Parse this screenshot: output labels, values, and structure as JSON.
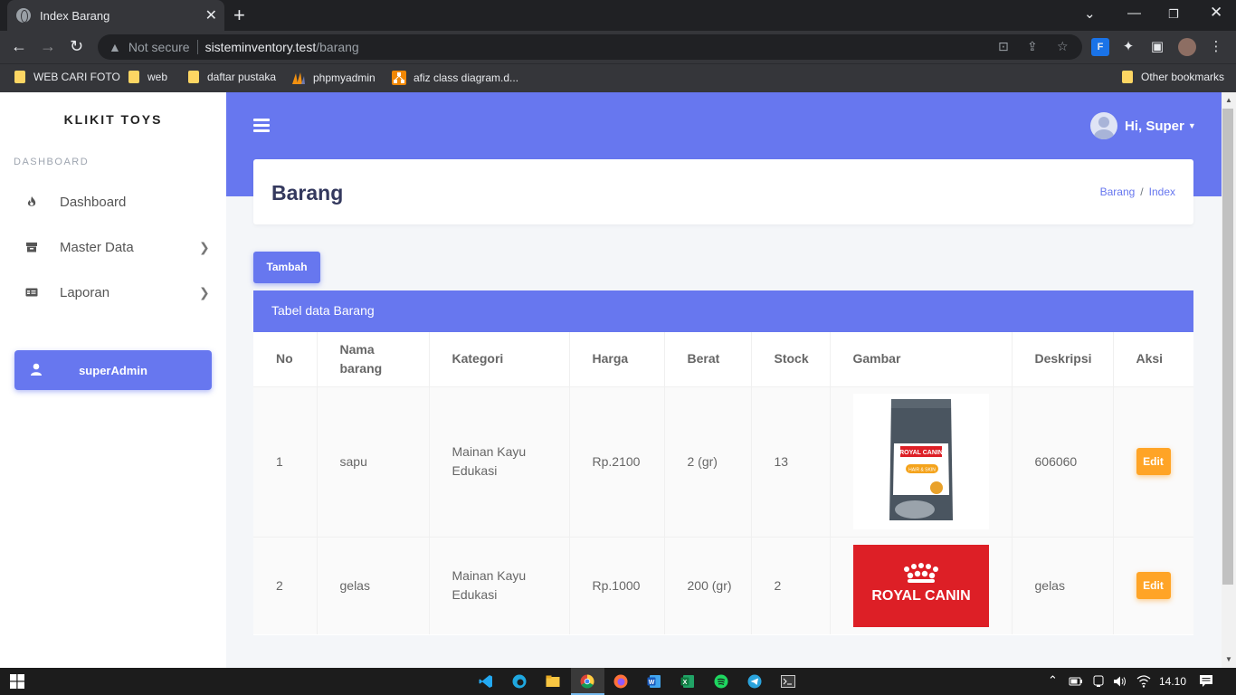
{
  "browser": {
    "tab_title": "Index Barang",
    "security_label": "Not secure",
    "url_host": "sisteminventory.test",
    "url_path": "/barang",
    "bookmarks": [
      {
        "label": "WEB CARI FOTO",
        "icon": "folder-icon"
      },
      {
        "label": "web",
        "icon": "folder-icon"
      },
      {
        "label": "daftar pustaka",
        "icon": "folder-icon"
      },
      {
        "label": "phpmyadmin",
        "icon": "phpmyadmin-icon"
      },
      {
        "label": "afiz class diagram.d...",
        "icon": "diagram-icon"
      }
    ],
    "other_bookmarks": "Other bookmarks"
  },
  "sidebar": {
    "brand": "KLIKIT TOYS",
    "section": "DASHBOARD",
    "items": [
      {
        "label": "Dashboard",
        "icon": "fire-icon"
      },
      {
        "label": "Master Data",
        "icon": "archive-icon"
      },
      {
        "label": "Laporan",
        "icon": "id-card-icon"
      }
    ],
    "user_button": "superAdmin"
  },
  "topbar": {
    "greeting": "Hi, Super"
  },
  "header": {
    "title": "Barang",
    "breadcrumb": [
      "Barang",
      "Index"
    ]
  },
  "actions": {
    "add_label": "Tambah"
  },
  "table": {
    "caption": "Tabel data Barang",
    "columns": [
      "No",
      "Nama barang",
      "Kategori",
      "Harga",
      "Berat",
      "Stock",
      "Gambar",
      "Deskripsi",
      "Aksi"
    ],
    "rows": [
      {
        "no": "1",
        "nama": "sapu",
        "kategori": "Mainan Kayu Edukasi",
        "harga": "Rp.2100",
        "berat": "2 (gr)",
        "stock": "13",
        "gambar_text": "ROYAL CANIN",
        "gambar_sub": "HAIR & SKIN",
        "deskripsi": "606060",
        "aksi": "Edit"
      },
      {
        "no": "2",
        "nama": "gelas",
        "kategori": "Mainan Kayu Edukasi",
        "harga": "Rp.1000",
        "berat": "200 (gr)",
        "stock": "2",
        "gambar_text": "ROYAL CANIN",
        "deskripsi": "gelas",
        "aksi": "Edit"
      }
    ]
  },
  "taskbar": {
    "clock": "14.10"
  },
  "colors": {
    "primary": "#6777ef",
    "warning": "#ffa426",
    "brand_red": "#dd1f26"
  }
}
